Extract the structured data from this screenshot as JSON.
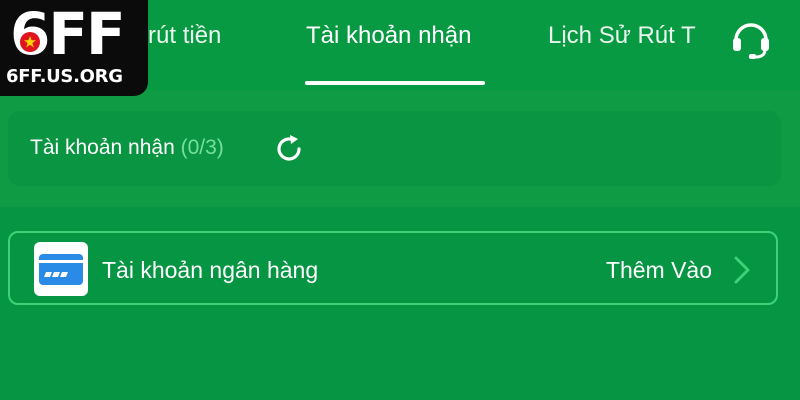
{
  "colors": {
    "background": "#0f9a44",
    "accent": "#3fd276",
    "count": "#74e09a"
  },
  "logo": {
    "main": "6FF",
    "domain": "6FF.US.ORG"
  },
  "tabs": [
    {
      "label": "u rút tiền",
      "active": false
    },
    {
      "label": "Tài khoản nhận",
      "active": true
    },
    {
      "label": "Lịch Sử Rút T",
      "active": false
    }
  ],
  "support": {
    "icon": "headset-icon"
  },
  "accounts": {
    "label": "Tài khoản nhận",
    "count": "(0/3)",
    "icon": "refresh-icon"
  },
  "bank": {
    "label": "Tài khoản ngân hàng",
    "action": "Thêm Vào",
    "icon": "bank-card-icon"
  }
}
